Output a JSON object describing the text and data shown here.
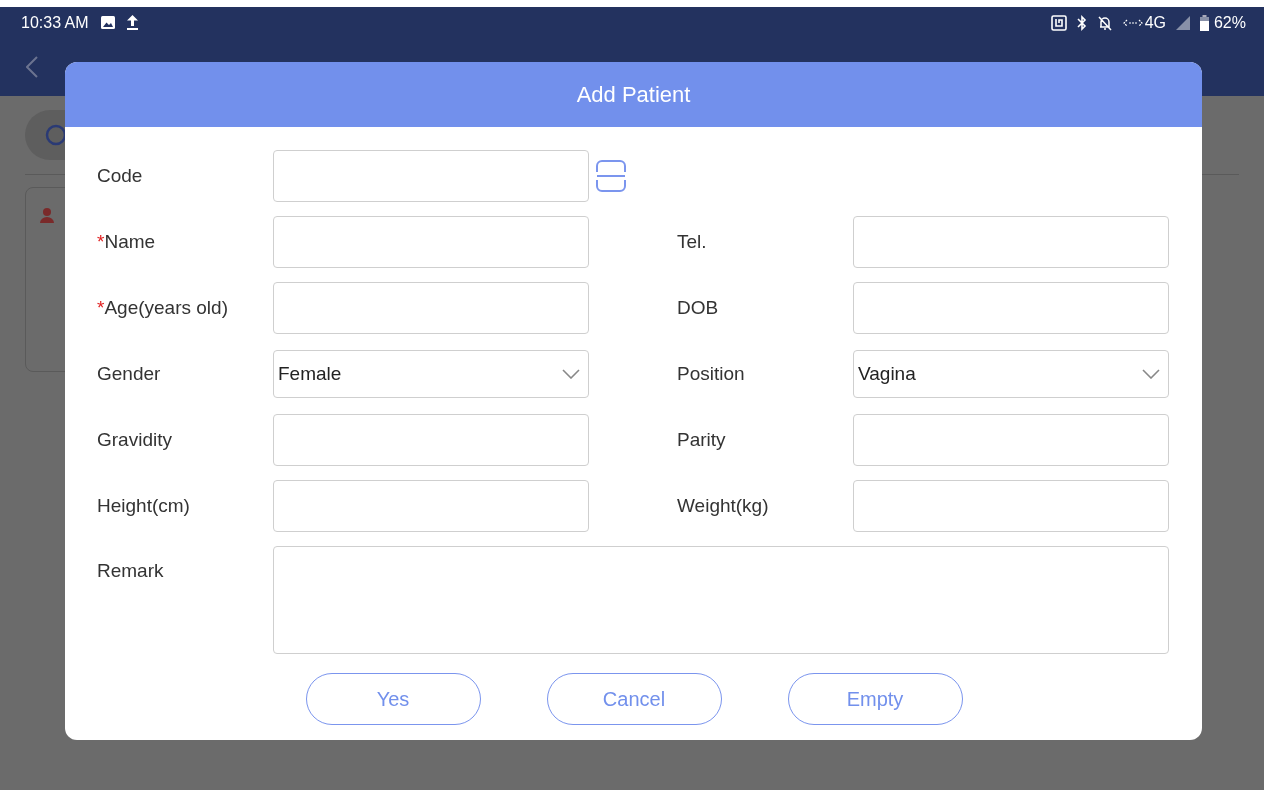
{
  "status_bar": {
    "time": "10:33 AM",
    "network": "4G",
    "battery": "62%"
  },
  "dialog": {
    "title": "Add Patient",
    "rows": [
      {
        "fields": [
          {
            "kind": "scan",
            "label": "Code"
          }
        ]
      },
      {
        "fields": [
          {
            "kind": "text",
            "label": "Name",
            "required_mark": "*"
          },
          {
            "kind": "text",
            "label": "Tel."
          }
        ]
      },
      {
        "fields": [
          {
            "kind": "text",
            "label": "Age(years old)",
            "required_mark": "*"
          },
          {
            "kind": "text",
            "label": "DOB"
          }
        ]
      },
      {
        "fields": [
          {
            "kind": "select",
            "label": "Gender",
            "value": "Female"
          },
          {
            "kind": "select",
            "label": "Position",
            "value": "Vagina"
          }
        ]
      },
      {
        "fields": [
          {
            "kind": "text",
            "label": "Gravidity"
          },
          {
            "kind": "text",
            "label": "Parity"
          }
        ]
      },
      {
        "fields": [
          {
            "kind": "text",
            "label": "Height(cm)"
          },
          {
            "kind": "text",
            "label": "Weight(kg)"
          }
        ]
      },
      {
        "fields": [
          {
            "kind": "textarea",
            "label": "Remark"
          }
        ]
      }
    ],
    "buttons": [
      "Yes",
      "Cancel",
      "Empty"
    ]
  }
}
